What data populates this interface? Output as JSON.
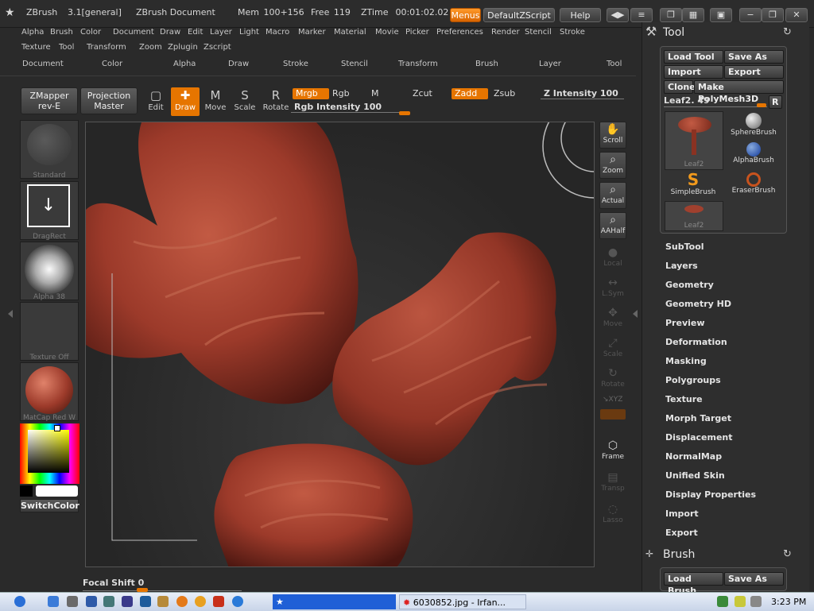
{
  "titlebar": {
    "app": "ZBrush",
    "version": "3.1[general]",
    "document": "ZBrush Document",
    "mem": "Mem 100+156",
    "free": "Free 119",
    "ztime": "ZTime  00:01:02.02",
    "menus_btn": "Menus",
    "script_btn": "DefaultZScript",
    "help_btn": "Help"
  },
  "menu_row1": [
    "Alpha",
    "Brush",
    "Color",
    "Document",
    "Draw",
    "Edit",
    "Layer",
    "Light",
    "Macro",
    "Marker",
    "Material",
    "Movie",
    "Picker",
    "Preferences",
    "Render",
    "Stencil",
    "Stroke"
  ],
  "menu_row2": [
    "Texture",
    "Tool",
    "Transform",
    "Zoom",
    "Zplugin",
    "Zscript"
  ],
  "menu_row3": [
    "Document",
    "Color",
    "Alpha",
    "Draw",
    "Stroke",
    "Stencil",
    "Transform",
    "Brush",
    "Layer",
    "Tool"
  ],
  "toolbar": {
    "zmapper_line1": "ZMapper",
    "zmapper_line2": "rev-E",
    "projection_line1": "Projection",
    "projection_line2": "Master",
    "edit": "Edit",
    "draw": "Draw",
    "move": "Move",
    "scale": "Scale",
    "rotate": "Rotate",
    "mrgb": "Mrgb",
    "rgb": "Rgb",
    "m": "M",
    "zcut": "Zcut",
    "zadd": "Zadd",
    "zsub": "Zsub",
    "z_intensity": "Z Intensity 100",
    "rgb_intensity": "Rgb Intensity 100"
  },
  "shelf": {
    "standard": "Standard",
    "dragrect": "DragRect",
    "alpha": "Alpha 38",
    "texture": "Texture Off",
    "matcap": "MatCap Red W",
    "switchcolor": "SwitchColor"
  },
  "canvas_tools": {
    "scroll": "Scroll",
    "zoom": "Zoom",
    "actual": "Actual",
    "aahalf": "AAHalf",
    "local": "Local",
    "lsym": "L.Sym",
    "move": "Move",
    "scale": "Scale",
    "rotate": "Rotate",
    "xyz": "↘XYZ",
    "frame": "Frame",
    "transp": "Transp",
    "lasso": "Lasso"
  },
  "focal_shift": "Focal Shift 0",
  "palette": {
    "title": "Tool",
    "load_tool": "Load Tool",
    "save_as": "Save As",
    "import": "Import",
    "export": "Export",
    "clone": "Clone",
    "make_polymesh": "Make PolyMesh3D",
    "leaf_slider": "Leaf2. 49",
    "r_btn": "R",
    "brushes": [
      "Leaf2",
      "SphereBrush",
      "AlphaBrush",
      "SimpleBrush",
      "EraserBrush",
      "Leaf2"
    ],
    "subsections": [
      "SubTool",
      "Layers",
      "Geometry",
      "Geometry HD",
      "Preview",
      "Deformation",
      "Masking",
      "Polygroups",
      "Texture",
      "Morph Target",
      "Displacement",
      "NormalMap",
      "Unified Skin",
      "Display Properties",
      "Import",
      "Export"
    ],
    "brush_title": "Brush",
    "brush_load": "Load Brush",
    "brush_save": "Save As"
  },
  "taskbar": {
    "app_window": "6030852.jpg - Irfan...",
    "clock": "3:23 PM"
  },
  "colors": {
    "accent_orange": "#e67500",
    "clay": "#9c3a2a"
  }
}
